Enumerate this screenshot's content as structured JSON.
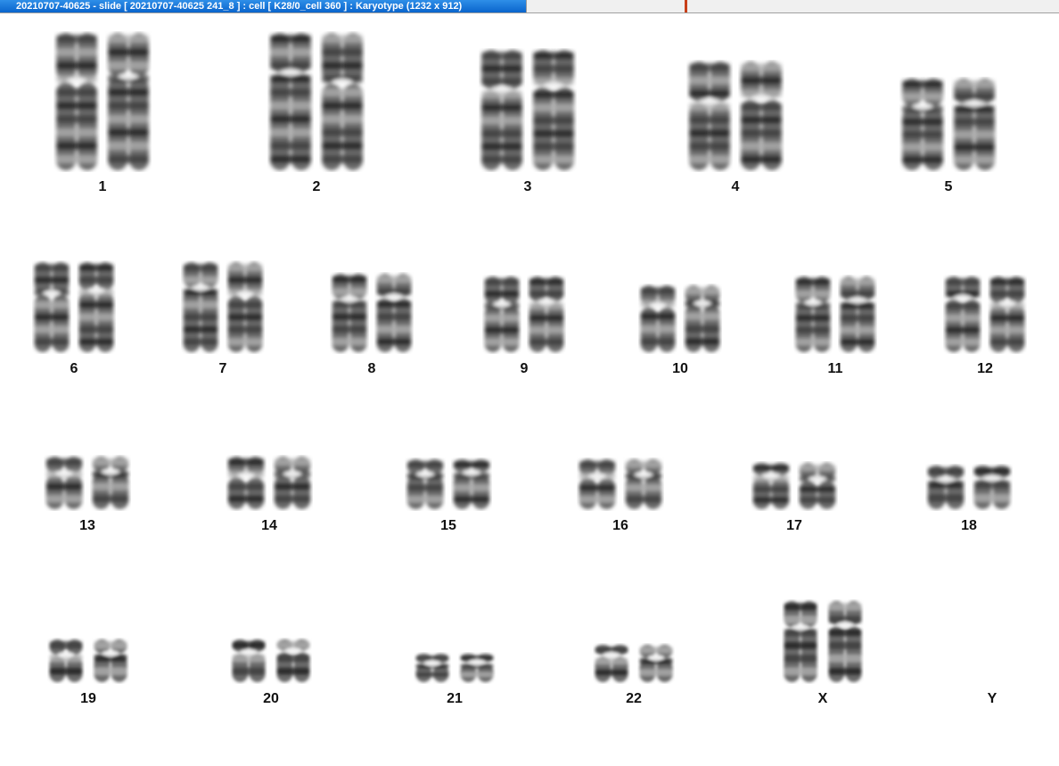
{
  "window": {
    "title": "20210707-40625 - slide [ 20210707-40625 241_8 ] : cell [ K28/0_cell 360 ] : Karyotype  (1232 x 912)"
  },
  "karyotype": {
    "rows": [
      [
        {
          "label": "1",
          "copies": 2
        },
        {
          "label": "2",
          "copies": 2
        },
        {
          "label": "3",
          "copies": 2
        },
        {
          "label": "4",
          "copies": 2
        },
        {
          "label": "5",
          "copies": 2
        }
      ],
      [
        {
          "label": "6",
          "copies": 2
        },
        {
          "label": "7",
          "copies": 2
        },
        {
          "label": "8",
          "copies": 2
        },
        {
          "label": "9",
          "copies": 2
        },
        {
          "label": "10",
          "copies": 2
        },
        {
          "label": "11",
          "copies": 2
        },
        {
          "label": "12",
          "copies": 2
        }
      ],
      [
        {
          "label": "13",
          "copies": 2
        },
        {
          "label": "14",
          "copies": 2
        },
        {
          "label": "15",
          "copies": 2
        },
        {
          "label": "16",
          "copies": 2
        },
        {
          "label": "17",
          "copies": 2
        },
        {
          "label": "18",
          "copies": 2
        }
      ],
      [
        {
          "label": "19",
          "copies": 2
        },
        {
          "label": "20",
          "copies": 2
        },
        {
          "label": "21",
          "copies": 2
        },
        {
          "label": "22",
          "copies": 2
        },
        {
          "label": "X",
          "copies": 2
        },
        {
          "label": "Y",
          "copies": 0
        }
      ]
    ]
  }
}
